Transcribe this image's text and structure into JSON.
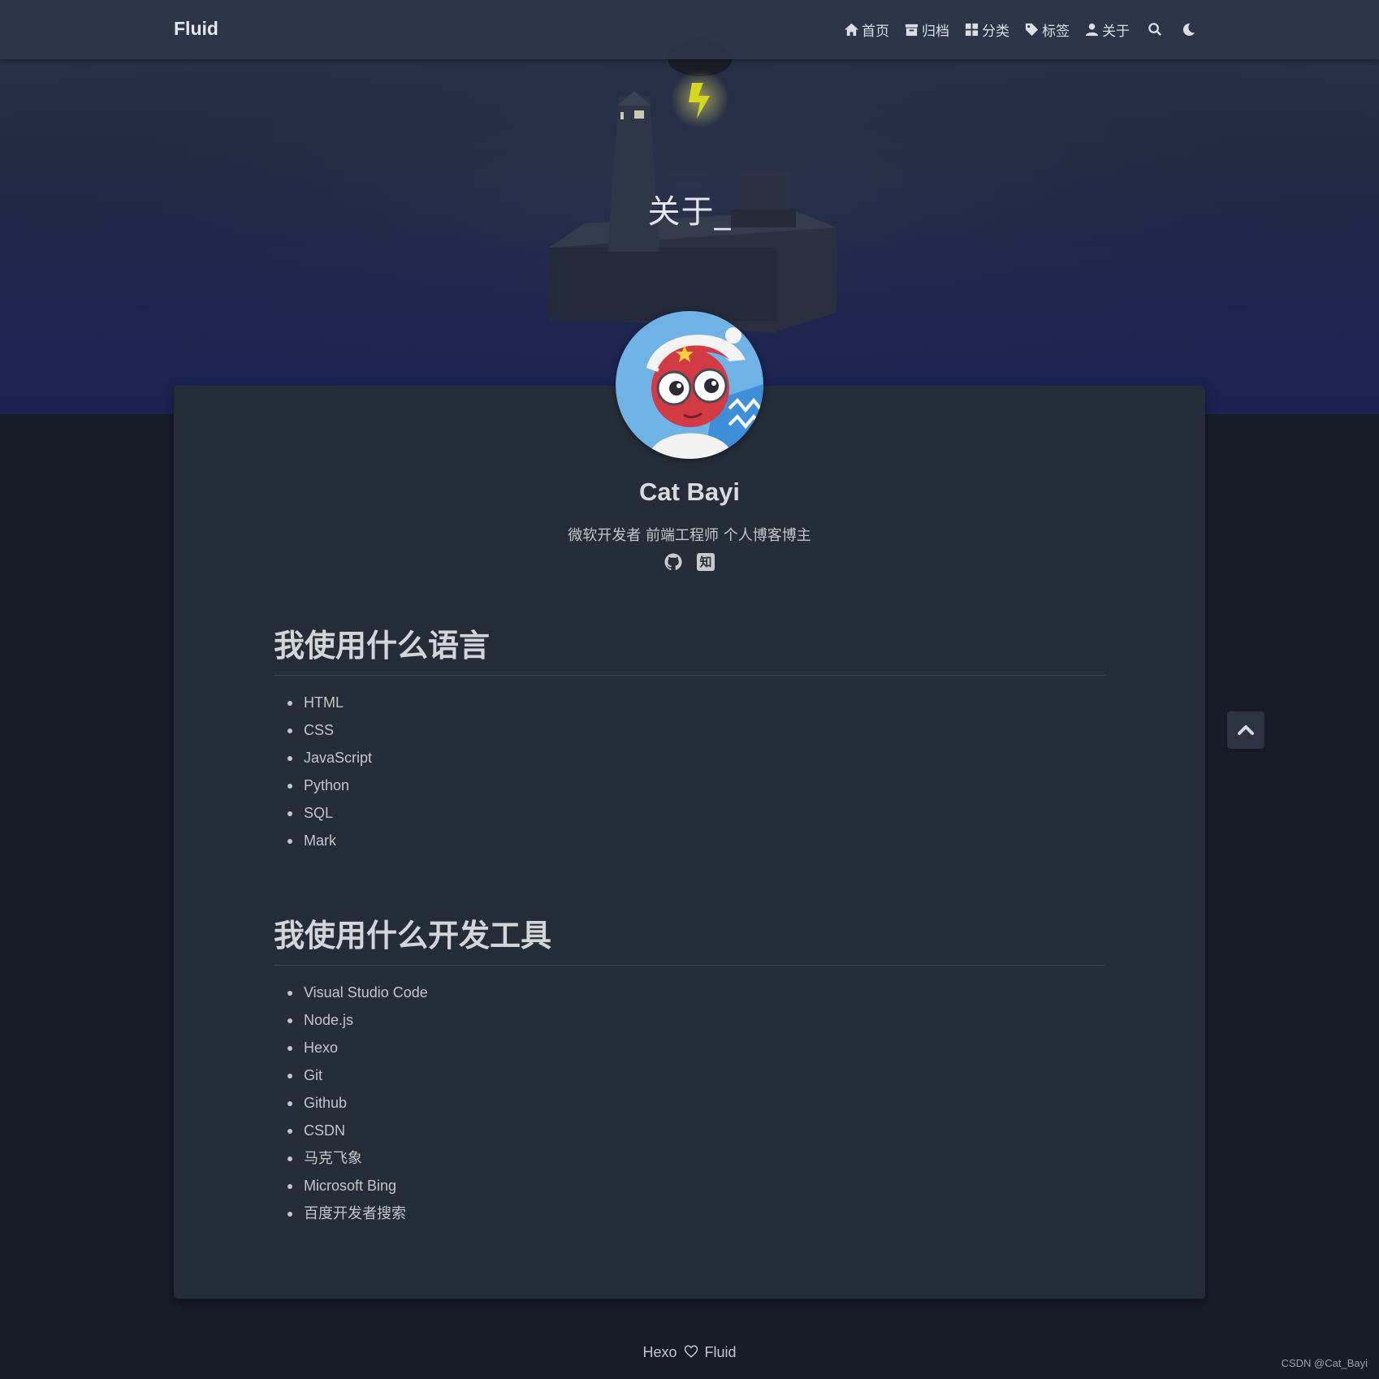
{
  "navbar": {
    "brand": "Fluid",
    "items": [
      {
        "label": "首页",
        "icon": "home-icon"
      },
      {
        "label": "归档",
        "icon": "archive-icon"
      },
      {
        "label": "分类",
        "icon": "category-icon"
      },
      {
        "label": "标签",
        "icon": "tag-icon"
      },
      {
        "label": "关于",
        "icon": "user-icon"
      }
    ],
    "search_icon": "search-icon",
    "theme_icon": "moon-icon"
  },
  "hero": {
    "title": "关于_"
  },
  "profile": {
    "name": "Cat Bayi",
    "intro": "微软开发者 前端工程师 个人博客博主",
    "links": [
      {
        "icon": "github-icon"
      },
      {
        "icon": "zhihu-icon",
        "glyph": "知"
      }
    ]
  },
  "sections": [
    {
      "title": "我使用什么语言",
      "items": [
        "HTML",
        "CSS",
        "JavaScript",
        "Python",
        "SQL",
        "Mark"
      ]
    },
    {
      "title": "我使用什么开发工具",
      "items": [
        "Visual Studio Code",
        "Node.js",
        "Hexo",
        "Git",
        "Github",
        "CSDN",
        "马克飞象",
        "Microsoft Bing",
        "百度开发者搜索"
      ]
    }
  ],
  "footer": {
    "left": "Hexo",
    "heart_icon": "heart-icon",
    "right": "Fluid"
  },
  "watermark": "CSDN @Cat_Bayi",
  "colors": {
    "page_background": "#181c27",
    "board_background": "#252d38",
    "navbar_background": "#2d364a",
    "text": "#c4c6c9",
    "lightning": "#d6d61e"
  }
}
